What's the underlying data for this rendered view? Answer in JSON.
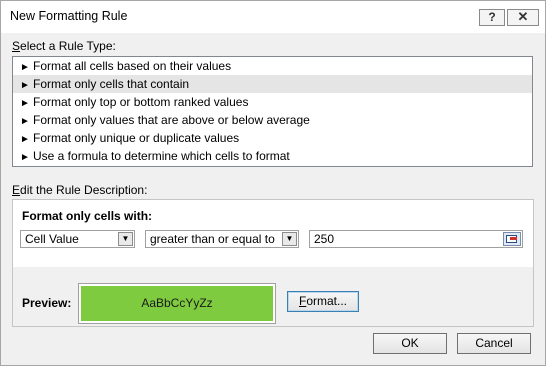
{
  "window": {
    "title": "New Formatting Rule",
    "help_label": "?",
    "close_label": "✕"
  },
  "rule_type": {
    "label_accel": "S",
    "label_rest": "elect a Rule Type:",
    "items": [
      {
        "arrow": "►",
        "label": "Format all cells based on their values",
        "selected": false
      },
      {
        "arrow": "►",
        "label": "Format only cells that contain",
        "selected": true
      },
      {
        "arrow": "►",
        "label": "Format only top or bottom ranked values",
        "selected": false
      },
      {
        "arrow": "►",
        "label": "Format only values that are above or below average",
        "selected": false
      },
      {
        "arrow": "►",
        "label": "Format only unique or duplicate values",
        "selected": false
      },
      {
        "arrow": "►",
        "label": "Use a formula to determine which cells to format",
        "selected": false
      }
    ]
  },
  "description": {
    "label_accel": "E",
    "label_rest": "dit the Rule Description:",
    "format_only_label": "Format only cells with:",
    "condition_field": "Cell Value",
    "operator": "greater than or equal to",
    "value": "250",
    "dropdown_arrow": "▼"
  },
  "preview": {
    "label": "Preview:",
    "sample_text": "AaBbCcYyZz",
    "fill_color": "#7fcb3f"
  },
  "buttons": {
    "format_accel": "F",
    "format_rest": "ormat...",
    "ok": "OK",
    "cancel": "Cancel"
  }
}
